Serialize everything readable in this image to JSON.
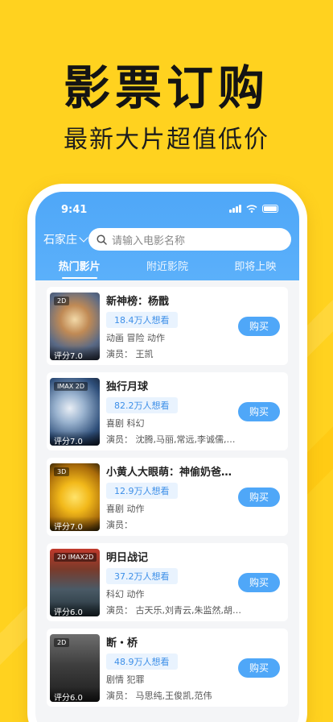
{
  "promo": {
    "headline": "影票订购",
    "subline": "最新大片超值低价"
  },
  "status_bar": {
    "time": "9:41"
  },
  "header": {
    "city": "石家庄",
    "search_placeholder": "请输入电影名称",
    "tabs": [
      {
        "label": "热门影片",
        "active": true
      },
      {
        "label": "附近影院",
        "active": false
      },
      {
        "label": "即将上映",
        "active": false
      }
    ]
  },
  "colors": {
    "brand": "#4FA7F8",
    "background": "#FFD21F"
  },
  "movies": [
    {
      "title": "新神榜：杨戬",
      "format": "2D",
      "score": "评分7.0",
      "want": "18.4万人想看",
      "genre": "动画 冒险 动作",
      "cast": "演员： 王凯",
      "buy": "购买"
    },
    {
      "title": "独行月球",
      "format": "IMAX 2D",
      "score": "评分7.0",
      "want": "82.2万人想看",
      "genre": "喜剧 科幻",
      "cast": "演员： 沈腾,马丽,常远,李诚儒,黄…",
      "buy": "购买"
    },
    {
      "title": "小黄人大眼萌：神偷奶爸前传",
      "format": "3D",
      "score": "评分7.0",
      "want": "12.9万人想看",
      "genre": "喜剧 动作",
      "cast": "演员：",
      "buy": "购买"
    },
    {
      "title": "明日战记",
      "format": "2D IMAX2D",
      "score": "评分6.0",
      "want": "37.2万人想看",
      "genre": "科幻 动作",
      "cast": "演员： 古天乐,刘青云,朱监然,胡子…",
      "buy": "购买"
    },
    {
      "title": "断・桥",
      "format": "2D",
      "score": "评分6.0",
      "want": "48.9万人想看",
      "genre": "剧情 犯罪",
      "cast": "演员： 马思纯,王俊凯,范伟",
      "buy": "购买"
    }
  ]
}
